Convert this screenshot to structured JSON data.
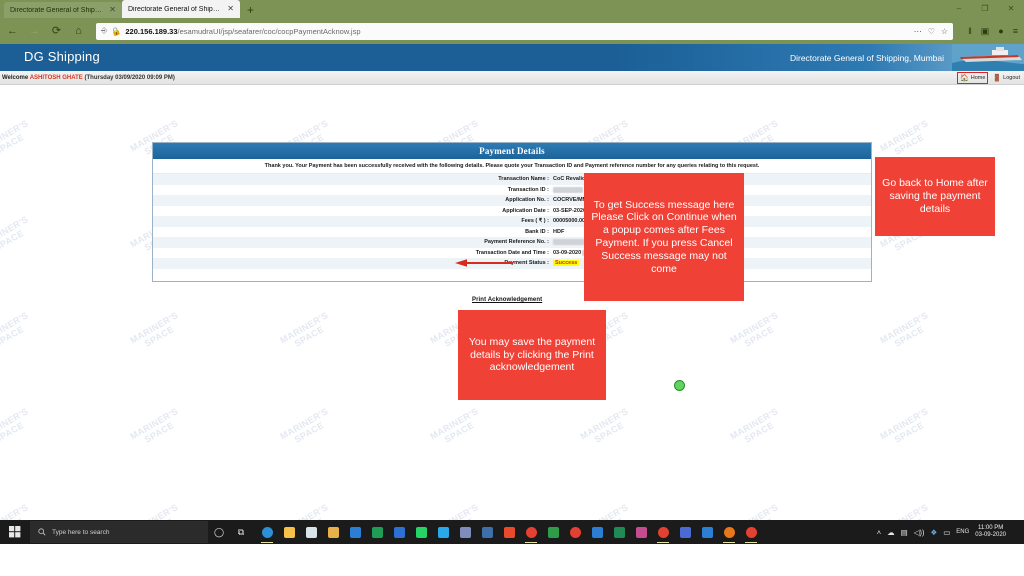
{
  "browser": {
    "tabs": [
      {
        "title": "Directorate General of Shipping : G",
        "active": false
      },
      {
        "title": "Directorate General of Shipping",
        "active": true
      }
    ],
    "newtab_label": "+",
    "window_controls": {
      "minimize": "–",
      "maximize": "❐",
      "close": "✕"
    },
    "nav": {
      "back": "←",
      "forward": "→",
      "reload": "⟳",
      "home": "⌂"
    },
    "url_host": "220.156.189.33",
    "url_path": "/esamudraUI/jsp/seafarer/coc/cocpPaymentAcknow.jsp",
    "url_actions": {
      "more": "⋯",
      "pocket": "♡",
      "bookmark": "☆"
    },
    "toolbar_icons": {
      "library": "‖",
      "sidebar": "▣",
      "account": "●",
      "menu": "≡"
    }
  },
  "site": {
    "brand": "DG Shipping",
    "org_name": "Directorate General of Shipping, Mumbai",
    "welcome_prefix": "Welcome",
    "user_name": "ASHITOSH GHATE",
    "session_datetime": "(Thursday 03/09/2020 09:09 PM)",
    "home_label": "Home",
    "logout_label": "Logout",
    "watermark_text": "MARINER'S SPACE"
  },
  "payment": {
    "card_title": "Payment Details",
    "thankyou": "Thank you. Your Payment has been successfully received with the following details. Please quote your Transaction ID and Payment reference number for any queries relating to this request.",
    "rows": [
      {
        "label": "Transaction Name :",
        "value": "CoC Revalidation Application",
        "redacted": 0
      },
      {
        "label": "Transaction ID :",
        "value": "",
        "redacted": 30
      },
      {
        "label": "Application No. :",
        "value": "COCRVE/MMD(M)/",
        "redacted": 36
      },
      {
        "label": "Application Date :",
        "value": "03-SEP-2020",
        "redacted": 0
      },
      {
        "label": "Fees ( ₹ ) :",
        "value": "00005000.00",
        "redacted": 0
      },
      {
        "label": "Bank ID :",
        "value": "HDF",
        "redacted": 0
      },
      {
        "label": "Payment Reference No. :",
        "value": "",
        "redacted": 62
      },
      {
        "label": "Transaction Date and Time :",
        "value": "03-09-2020",
        "redacted": 42
      },
      {
        "label": "Payment Status :",
        "value": "Success",
        "redacted": 0
      }
    ],
    "status_value": "Success",
    "print_ack_label": "Print Acknowledgement",
    "status_highlight_bg": "#ffff00",
    "status_text_color": "#d2291d"
  },
  "annotations": {
    "color": "#ef4136",
    "success_note": "To get Success message here Please Click on Continue when a popup comes after Fees Payment. If you press Cancel Success message may not come",
    "home_note": "Go back to Home after saving the payment details",
    "print_note": "You may save the payment details by clicking the Print acknowledgement"
  },
  "taskbar": {
    "search_placeholder": "Type here to search",
    "search_icon": "search-icon",
    "cortana_icon": "◯",
    "taskview_icon": "⧉",
    "tray": {
      "chevron": "˄",
      "cloud": "☁",
      "network": "▤",
      "volume": "◁))",
      "dropbox": "❖",
      "battery": "▭",
      "language": "ENG"
    },
    "clock_time": "11:00 PM",
    "clock_date": "03-09-2020",
    "apps": [
      {
        "name": "edge",
        "color": "#2d8fd5"
      },
      {
        "name": "file-explorer",
        "color": "#f7c04a"
      },
      {
        "name": "microsoft-store",
        "color": "#d8e3ea"
      },
      {
        "name": "folder",
        "color": "#e8b04b"
      },
      {
        "name": "mail",
        "color": "#2a7fd4"
      },
      {
        "name": "u-app",
        "color": "#1f9d55"
      },
      {
        "name": "zoom",
        "color": "#2d6fd4"
      },
      {
        "name": "whatsapp",
        "color": "#25d366"
      },
      {
        "name": "telegram",
        "color": "#29a9e9"
      },
      {
        "name": "lock-app",
        "color": "#7f8dbd"
      },
      {
        "name": "share",
        "color": "#3f6fa8"
      },
      {
        "name": "red-app",
        "color": "#ea4a2c"
      },
      {
        "name": "chrome-1",
        "color": "#e34133"
      },
      {
        "name": "green-app",
        "color": "#2e9d4a"
      },
      {
        "name": "chrome-2",
        "color": "#e34133"
      },
      {
        "name": "vscode",
        "color": "#2a7fd4"
      },
      {
        "name": "block-app",
        "color": "#1f8a55"
      },
      {
        "name": "paint",
        "color": "#c44c8f"
      },
      {
        "name": "chrome-3",
        "color": "#e34133"
      },
      {
        "name": "phone",
        "color": "#4a6bd4"
      },
      {
        "name": "teams",
        "color": "#2d7fd4"
      },
      {
        "name": "firefox",
        "color": "#e8761b"
      },
      {
        "name": "chrome-4",
        "color": "#e34133"
      }
    ]
  }
}
